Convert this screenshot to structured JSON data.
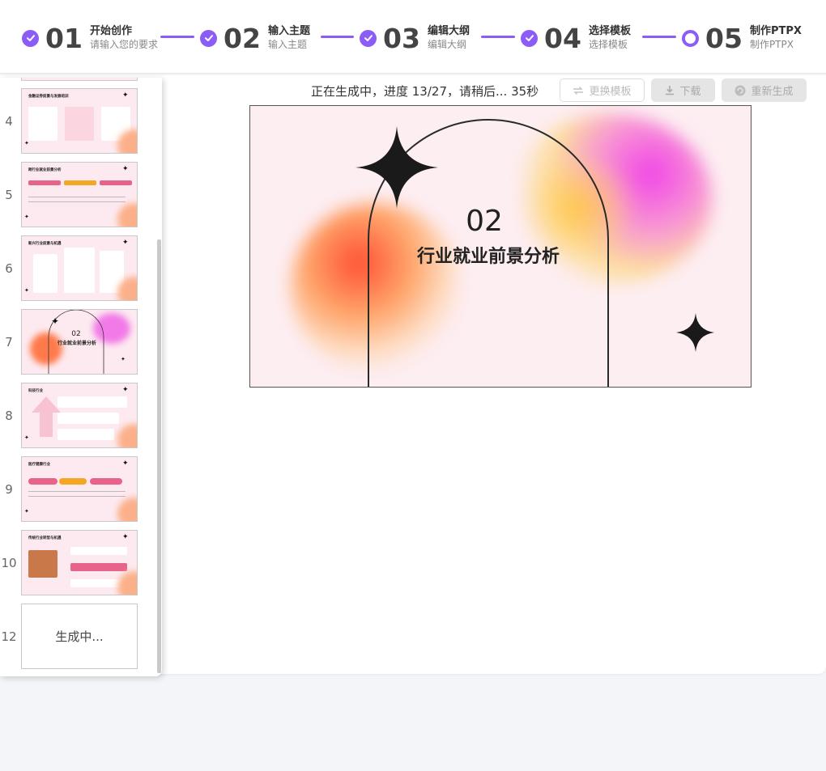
{
  "steps": [
    {
      "num": "01",
      "title": "开始创作",
      "sub": "请输入您的要求",
      "state": "done"
    },
    {
      "num": "02",
      "title": "输入主题",
      "sub": "输入主题",
      "state": "done"
    },
    {
      "num": "03",
      "title": "编辑大纲",
      "sub": "编辑大纲",
      "state": "done"
    },
    {
      "num": "04",
      "title": "选择模板",
      "sub": "选择模板",
      "state": "done"
    },
    {
      "num": "05",
      "title": "制作PTPX",
      "sub": "制作PTPX",
      "state": "current"
    }
  ],
  "toolbar": {
    "progress": "正在生成中，进度 13/27，请稍后... 35秒",
    "change_template": "更换模板",
    "download": "下载",
    "regenerate": "重新生成"
  },
  "accent_color": "#8b5cf6",
  "thumbnails": [
    {
      "num": "4",
      "title": "金融证券前景与发展培训"
    },
    {
      "num": "5",
      "title": "跨行业就业前景分析"
    },
    {
      "num": "6",
      "title": "新兴行业前景与机遇"
    },
    {
      "num": "7",
      "title": "行业就业前景分析",
      "section": "02"
    },
    {
      "num": "8",
      "title": "科技行业"
    },
    {
      "num": "9",
      "title": "医疗健康行业"
    },
    {
      "num": "10",
      "title": "传统行业转型与机遇"
    },
    {
      "num": "12",
      "status": "生成中..."
    }
  ],
  "slide": {
    "section_number": "02",
    "title": "行业就业前景分析"
  }
}
